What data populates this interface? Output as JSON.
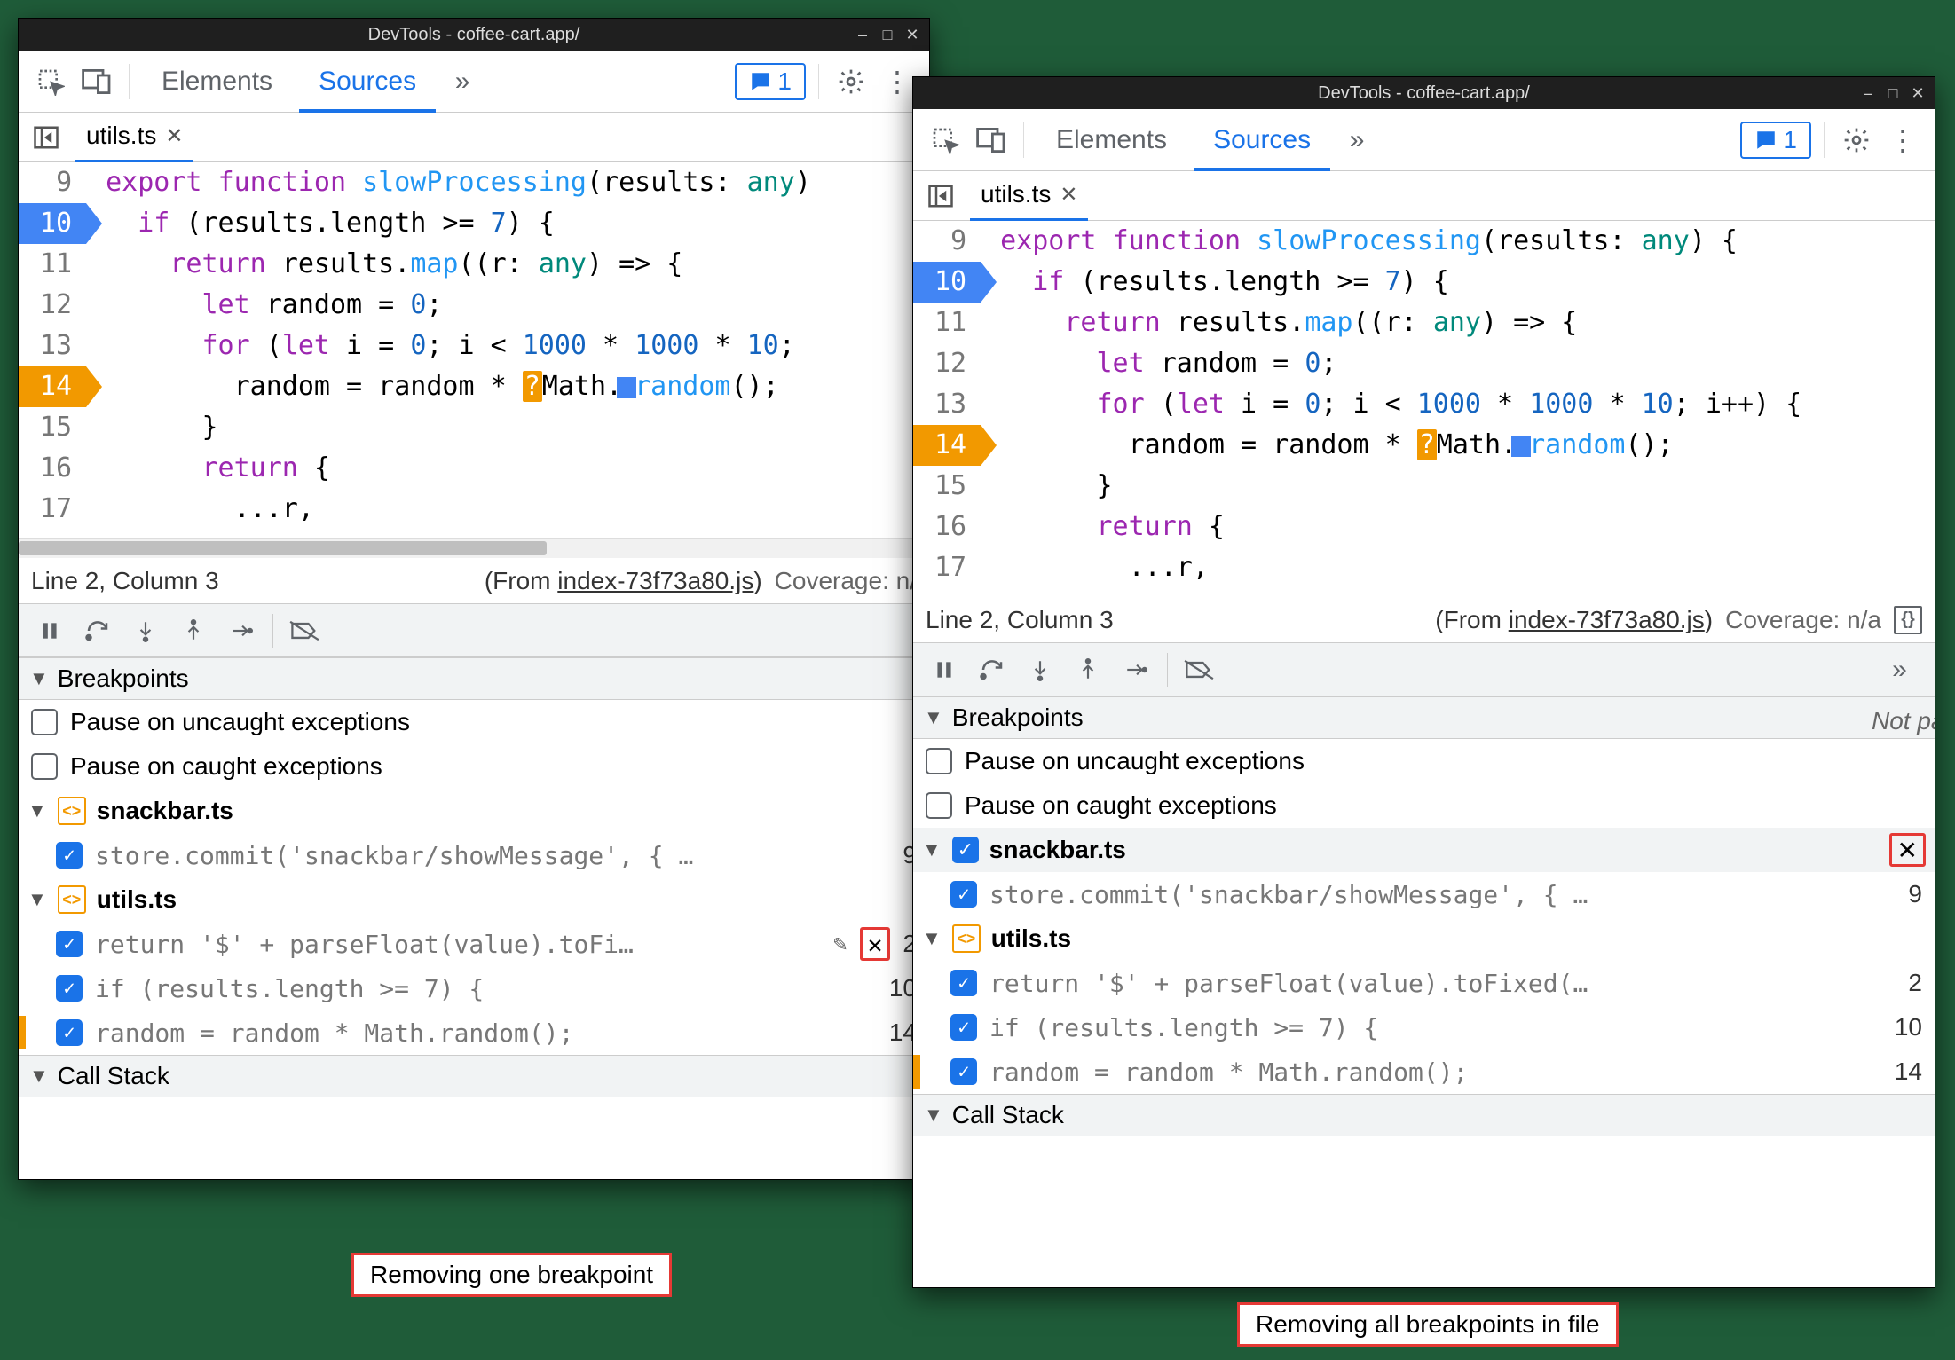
{
  "captions": {
    "left": "Removing one breakpoint",
    "right": "Removing all breakpoints in file"
  },
  "windows": [
    {
      "title": "DevTools - coffee-cart.app/",
      "toolbar": {
        "tabs": [
          "Elements",
          "Sources"
        ],
        "active": 1,
        "messages": "1"
      },
      "file_tab": "utils.ts",
      "code": {
        "start": 9,
        "blue_bp": 10,
        "orange_bp": 14,
        "lines": [
          {
            "n": 9,
            "t": "export function slowProcessing(results: any)"
          },
          {
            "n": 10,
            "t": "  if (results.length >= 7) {"
          },
          {
            "n": 11,
            "t": "    return results.map((r: any) => {"
          },
          {
            "n": 12,
            "t": "      let random = 0;"
          },
          {
            "n": 13,
            "t": "      for (let i = 0; i < 1000 * 1000 * 10;"
          },
          {
            "n": 14,
            "t": "        random = random * Math.random();"
          },
          {
            "n": 15,
            "t": "      }"
          },
          {
            "n": 16,
            "t": "      return {"
          },
          {
            "n": 17,
            "t": "        ...r,"
          }
        ]
      },
      "status": {
        "cursor": "Line 2, Column 3",
        "from_label": "(From ",
        "from_file": "index-73f73a80.js",
        "from_close": ")",
        "coverage": "Coverage: n/"
      },
      "sections": {
        "breakpoints": "Breakpoints",
        "callstack": "Call Stack"
      },
      "pause_rows": [
        "Pause on uncaught exceptions",
        "Pause on caught exceptions"
      ],
      "bp_groups": [
        {
          "file": "snackbar.ts",
          "items": [
            {
              "code": "store.commit('snackbar/showMessage', { …",
              "ln": "9",
              "checked": true
            }
          ]
        },
        {
          "file": "utils.ts",
          "items": [
            {
              "code": "return '$' + parseFloat(value).toFi…",
              "ln": "2",
              "checked": true,
              "hover": true
            },
            {
              "code": "if (results.length >= 7) {",
              "ln": "10",
              "checked": true
            },
            {
              "code": "random = random * Math.random();",
              "ln": "14",
              "checked": true,
              "orange": true
            }
          ]
        }
      ]
    },
    {
      "title": "DevTools - coffee-cart.app/",
      "toolbar": {
        "tabs": [
          "Elements",
          "Sources"
        ],
        "active": 1,
        "messages": "1"
      },
      "file_tab": "utils.ts",
      "code": {
        "start": 9,
        "blue_bp": 10,
        "orange_bp": 14,
        "lines": [
          {
            "n": 9,
            "t": "export function slowProcessing(results: any) {"
          },
          {
            "n": 10,
            "t": "  if (results.length >= 7) {"
          },
          {
            "n": 11,
            "t": "    return results.map((r: any) => {"
          },
          {
            "n": 12,
            "t": "      let random = 0;"
          },
          {
            "n": 13,
            "t": "      for (let i = 0; i < 1000 * 1000 * 10; i++) {"
          },
          {
            "n": 14,
            "t": "        random = random * Math.random();"
          },
          {
            "n": 15,
            "t": "      }"
          },
          {
            "n": 16,
            "t": "      return {"
          },
          {
            "n": 17,
            "t": "        ...r,"
          }
        ]
      },
      "status": {
        "cursor": "Line 2, Column 3",
        "from_label": "(From ",
        "from_file": "index-73f73a80.js",
        "from_close": ")",
        "coverage": "Coverage: n/a"
      },
      "sections": {
        "breakpoints": "Breakpoints",
        "callstack": "Call Stack"
      },
      "pause_rows": [
        "Pause on uncaught exceptions",
        "Pause on caught exceptions"
      ],
      "right_panel": {
        "not_paused": "Not pa"
      },
      "bp_groups": [
        {
          "file": "snackbar.ts",
          "hover": true,
          "items": [
            {
              "code": "store.commit('snackbar/showMessage', { …",
              "ln": "9",
              "checked": true
            }
          ]
        },
        {
          "file": "utils.ts",
          "items": [
            {
              "code": "return '$' + parseFloat(value).toFixed(…",
              "ln": "2",
              "checked": true
            },
            {
              "code": "if (results.length >= 7) {",
              "ln": "10",
              "checked": true
            },
            {
              "code": "random = random * Math.random();",
              "ln": "14",
              "checked": true,
              "orange": true
            }
          ]
        }
      ]
    }
  ]
}
